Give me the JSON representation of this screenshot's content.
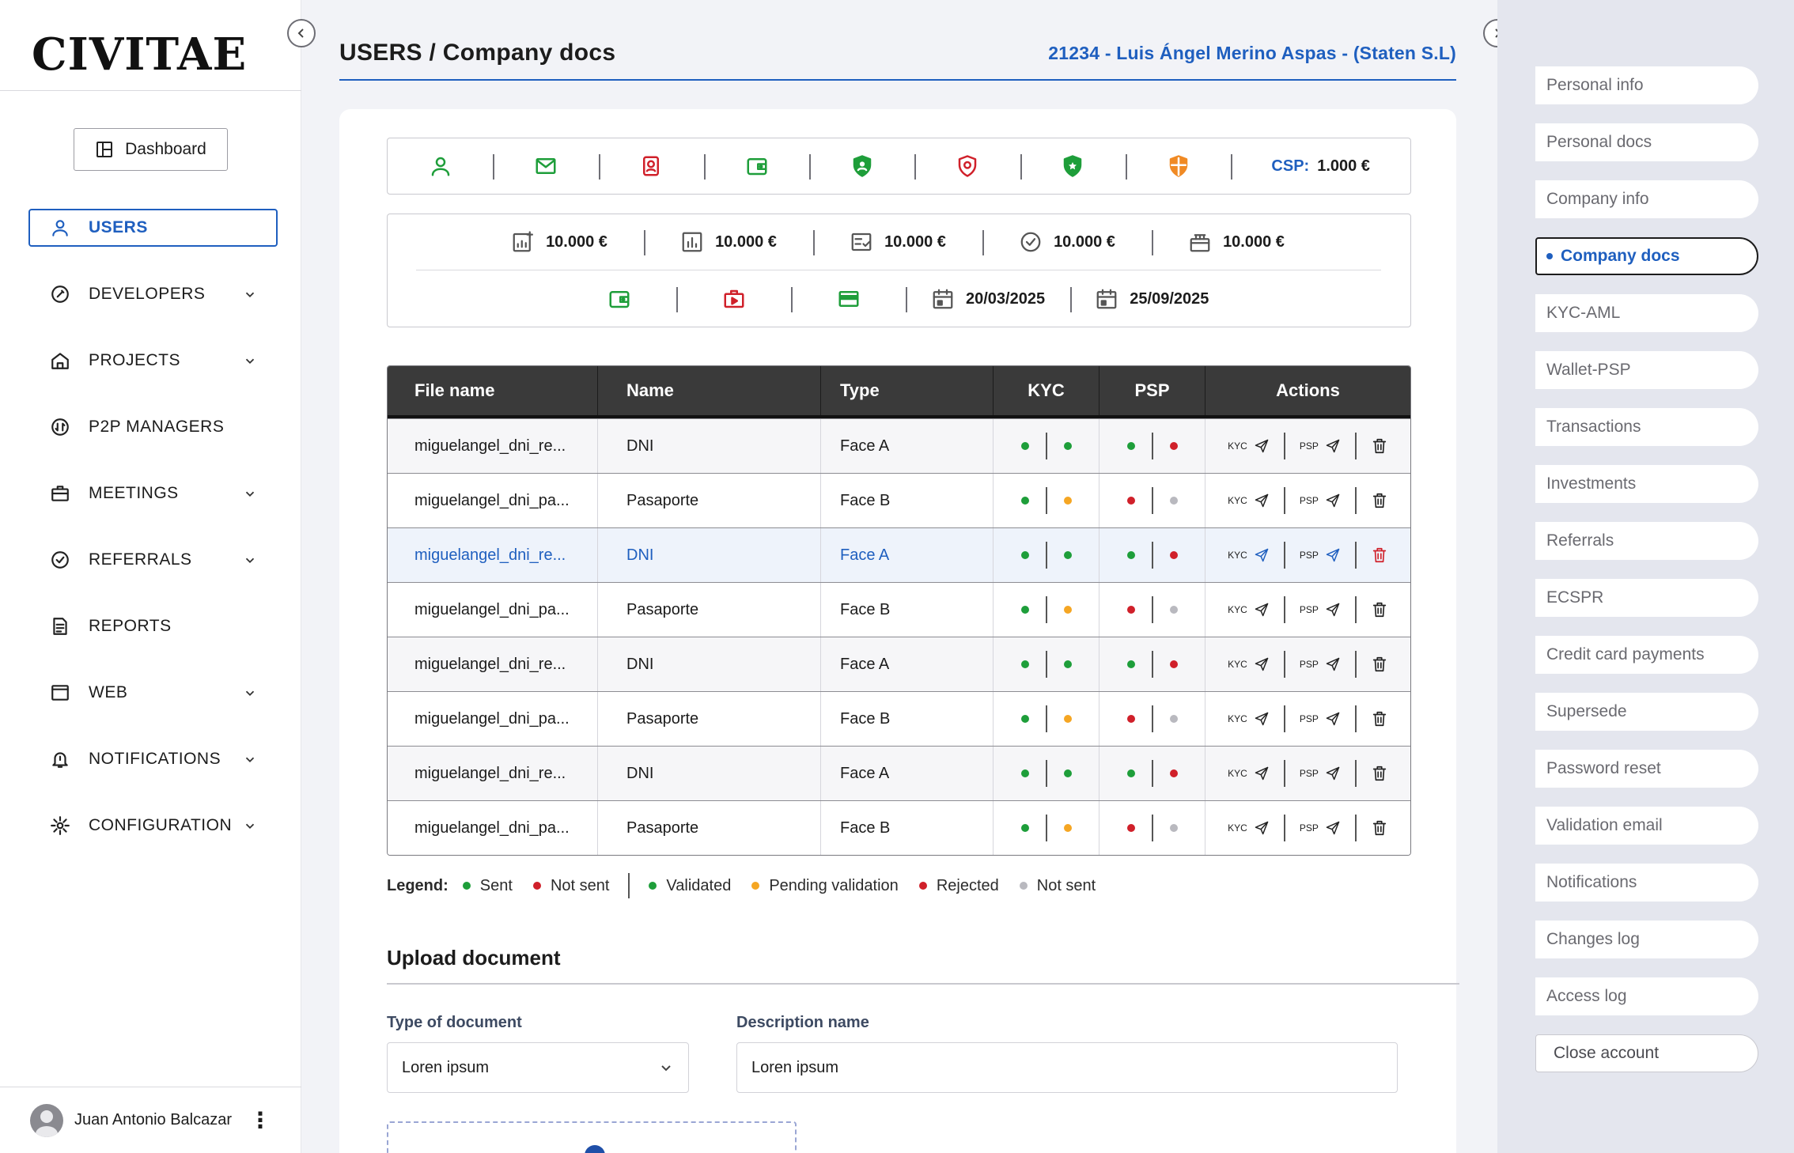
{
  "sidebar": {
    "logo": "CIVITAE",
    "dashboard_label": "Dashboard",
    "nav": [
      {
        "label": "USERS",
        "icon": "user-icon",
        "active": true,
        "expandable": false
      },
      {
        "label": "DEVELOPERS",
        "icon": "tools-icon",
        "active": false,
        "expandable": true
      },
      {
        "label": "PROJECTS",
        "icon": "home-icon",
        "active": false,
        "expandable": true
      },
      {
        "label": "P2P MANAGERS",
        "icon": "exchange-icon",
        "active": false,
        "expandable": false
      },
      {
        "label": "MEETINGS",
        "icon": "briefcase-icon",
        "active": false,
        "expandable": true
      },
      {
        "label": "REFERRALS",
        "icon": "check-circle-icon",
        "active": false,
        "expandable": true
      },
      {
        "label": "REPORTS",
        "icon": "document-icon",
        "active": false,
        "expandable": false
      },
      {
        "label": "WEB",
        "icon": "browser-window-icon",
        "active": false,
        "expandable": true
      },
      {
        "label": "NOTIFICATIONS",
        "icon": "bell-icon",
        "active": false,
        "expandable": true
      },
      {
        "label": "CONFIGURATION",
        "icon": "gear-icon",
        "active": false,
        "expandable": true
      }
    ],
    "user_name": "Juan Antonio Balcazar"
  },
  "header": {
    "title": "USERS / Company docs",
    "user_ref": "21234 - Luis Ángel Merino Aspas - (Staten S.L)"
  },
  "status_bar": {
    "icons": [
      {
        "name": "user-icon",
        "color": "#1e9e3a"
      },
      {
        "name": "mail-icon",
        "color": "#1e9e3a"
      },
      {
        "name": "id-badge-icon",
        "color": "#d0202a"
      },
      {
        "name": "wallet-icon",
        "color": "#1e9e3a"
      },
      {
        "name": "shield-user-icon",
        "color": "#1e9e3a"
      },
      {
        "name": "shield-alert-icon",
        "color": "#d0202a"
      },
      {
        "name": "shield-star-icon",
        "color": "#1e9e3a"
      },
      {
        "name": "shield-half-icon",
        "color": "#f08a24"
      }
    ],
    "csp_label": "CSP:",
    "csp_value": "1.000 €"
  },
  "amounts": {
    "row1": [
      {
        "icon": "chart-plus-icon",
        "value": "10.000 €"
      },
      {
        "icon": "bar-chart-icon",
        "value": "10.000 €"
      },
      {
        "icon": "checklist-icon",
        "value": "10.000 €"
      },
      {
        "icon": "check-circle-icon",
        "value": "10.000 €"
      },
      {
        "icon": "gift-icon",
        "value": "10.000 €"
      }
    ],
    "row2_icons": [
      {
        "name": "wallet-icon",
        "color": "#1e9e3a"
      },
      {
        "name": "play-briefcase-icon",
        "color": "#d0202a"
      },
      {
        "name": "credit-card-icon",
        "color": "#1e9e3a"
      }
    ],
    "dates": [
      "20/03/2025",
      "25/09/2025"
    ]
  },
  "table": {
    "headers": [
      "File name",
      "Name",
      "Type",
      "KYC",
      "PSP",
      "Actions"
    ],
    "rows": [
      {
        "file": "miguelangel_dni_re...",
        "name": "DNI",
        "type": "Face A",
        "kyc": [
          "green",
          "green"
        ],
        "psp": [
          "green",
          "red"
        ],
        "selected": false
      },
      {
        "file": "miguelangel_dni_pa...",
        "name": "Pasaporte",
        "type": "Face B",
        "kyc": [
          "green",
          "orange"
        ],
        "psp": [
          "red",
          "gray"
        ],
        "selected": false
      },
      {
        "file": "miguelangel_dni_re...",
        "name": "DNI",
        "type": "Face A",
        "kyc": [
          "green",
          "green"
        ],
        "psp": [
          "green",
          "red"
        ],
        "selected": true
      },
      {
        "file": "miguelangel_dni_pa...",
        "name": "Pasaporte",
        "type": "Face B",
        "kyc": [
          "green",
          "orange"
        ],
        "psp": [
          "red",
          "gray"
        ],
        "selected": false
      },
      {
        "file": "miguelangel_dni_re...",
        "name": "DNI",
        "type": "Face A",
        "kyc": [
          "green",
          "green"
        ],
        "psp": [
          "green",
          "red"
        ],
        "selected": false
      },
      {
        "file": "miguelangel_dni_pa...",
        "name": "Pasaporte",
        "type": "Face B",
        "kyc": [
          "green",
          "orange"
        ],
        "psp": [
          "red",
          "gray"
        ],
        "selected": false
      },
      {
        "file": "miguelangel_dni_re...",
        "name": "DNI",
        "type": "Face A",
        "kyc": [
          "green",
          "green"
        ],
        "psp": [
          "green",
          "red"
        ],
        "selected": false
      },
      {
        "file": "miguelangel_dni_pa...",
        "name": "Pasaporte",
        "type": "Face B",
        "kyc": [
          "green",
          "orange"
        ],
        "psp": [
          "red",
          "gray"
        ],
        "selected": false
      }
    ],
    "action_labels": {
      "kyc": "KYC",
      "psp": "PSP"
    }
  },
  "legend": {
    "title": "Legend:",
    "group1": [
      {
        "label": "Sent",
        "color": "green"
      },
      {
        "label": "Not sent",
        "color": "red"
      }
    ],
    "group2": [
      {
        "label": "Validated",
        "color": "green"
      },
      {
        "label": "Pending validation",
        "color": "orange"
      },
      {
        "label": "Rejected",
        "color": "red"
      },
      {
        "label": "Not sent",
        "color": "gray"
      }
    ]
  },
  "upload": {
    "title": "Upload document",
    "type_label": "Type of document",
    "type_value": "Loren ipsum",
    "desc_label": "Description name",
    "desc_value": "Loren ipsum"
  },
  "right_menu": {
    "items": [
      "Personal info",
      "Personal docs",
      "Company info",
      "Company docs",
      "KYC-AML",
      "Wallet-PSP",
      "Transactions",
      "Investments",
      "Referrals",
      "ECSPR",
      "Credit card payments",
      "Supersede",
      "Password reset",
      "Validation email",
      "Notifications",
      "Changes log",
      "Access log"
    ],
    "active": "Company docs",
    "close_label": "Close account"
  },
  "colors": {
    "green": "#1e9e3a",
    "red": "#d0202a",
    "orange": "#f5a623",
    "gray": "#b9b9bf",
    "accent": "#1f5fbf"
  }
}
